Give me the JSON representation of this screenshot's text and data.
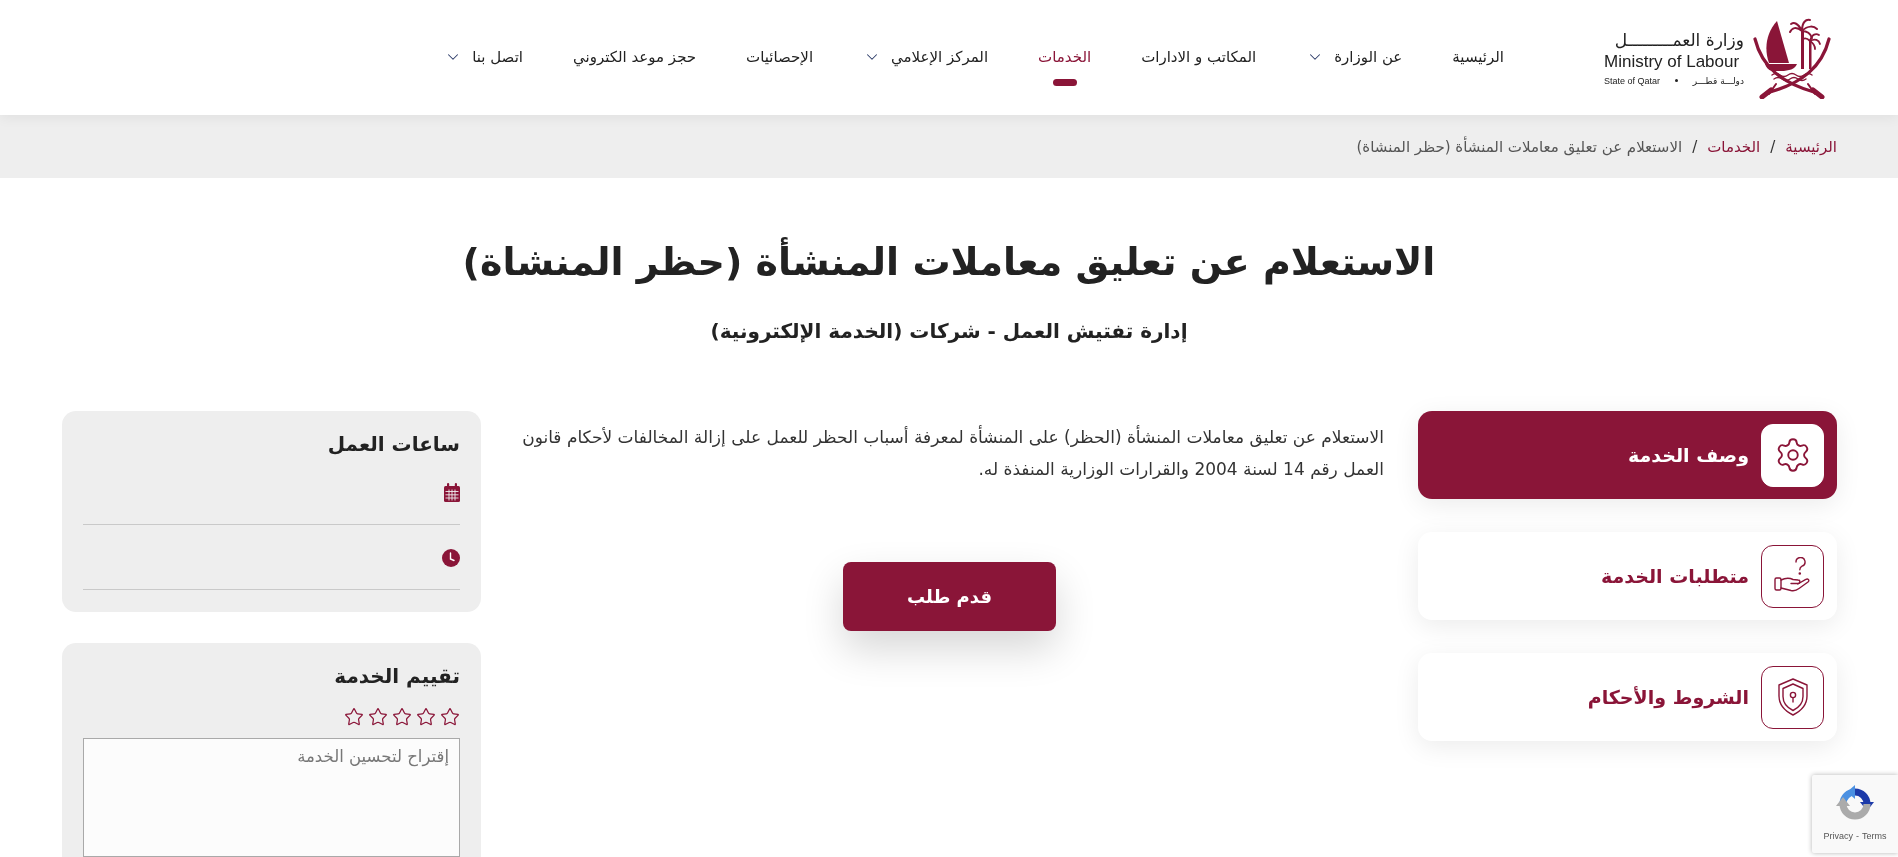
{
  "header": {
    "logo": {
      "name_arabic": "وزارة العمـــــــــل",
      "name_english": "Ministry of Labour",
      "country_english": "State of Qatar",
      "country_arabic": "دولـــة قطـــر"
    },
    "nav": [
      {
        "label": "الرئيسية",
        "selected": false,
        "dropdown": false
      },
      {
        "label": "عن الوزارة",
        "selected": false,
        "dropdown": true
      },
      {
        "label": "المكاتب و الادارات",
        "selected": false,
        "dropdown": false
      },
      {
        "label": "الخدمات",
        "selected": true,
        "dropdown": false
      },
      {
        "label": "المركز الإعلامي",
        "selected": false,
        "dropdown": true
      },
      {
        "label": "الإحصائيات",
        "selected": false,
        "dropdown": false
      },
      {
        "label": "حجز موعد الكتروني",
        "selected": false,
        "dropdown": false
      },
      {
        "label": "اتصل بنا",
        "selected": false,
        "dropdown": true
      }
    ]
  },
  "breadcrumb": [
    {
      "kind": "link",
      "label": "الرئيسية"
    },
    {
      "kind": "separator",
      "label": "/"
    },
    {
      "kind": "link",
      "label": "الخدمات"
    },
    {
      "kind": "separator",
      "label": "/"
    },
    {
      "kind": "current",
      "label": "الاستعلام عن تعليق معاملات المنشأة (حظر المنشاة)"
    }
  ],
  "page_title": "الاستعلام عن تعليق معاملات المنشأة (حظر المنشاة)",
  "subtitle": "إدارة تفتيش العمل - شركات (الخدمة الإلكترونية)",
  "service_tabs": [
    {
      "label": "وصف الخدمة",
      "selected": true
    },
    {
      "label": "متطلبات الخدمة",
      "selected": false
    },
    {
      "label": "الشروط والأحكام",
      "selected": false
    }
  ],
  "description": "الاستعلام عن تعليق معاملات المنشأة (الحظر) على المنشأة لمعرفة أسباب الحظر للعمل على إزالة المخالفات لأحكام قانون العمل رقم 14 لسنة 2004 والقرارات الوزارية المنفذة له.",
  "apply_button": "قدم طلب",
  "working_hours": {
    "title": "ساعات العمل"
  },
  "rating": {
    "title": "تقييم الخدمة",
    "stars": 0,
    "suggestion": {
      "placeholder": "إقتراح لتحسين الخدمة"
    }
  },
  "captcha": {
    "privacy_link": "Privacy",
    "separator": "-",
    "terms_link": "Terms"
  }
}
